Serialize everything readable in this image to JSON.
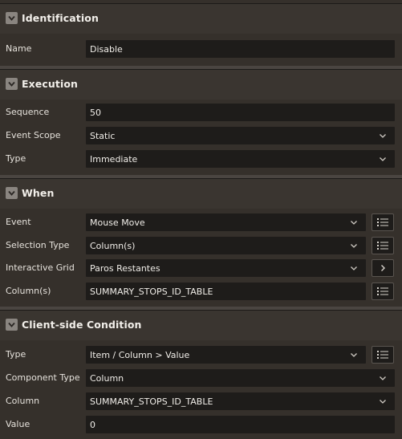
{
  "sections": {
    "identification": {
      "title": "Identification",
      "name": {
        "label": "Name",
        "value": "Disable"
      }
    },
    "execution": {
      "title": "Execution",
      "sequence": {
        "label": "Sequence",
        "value": "50"
      },
      "event_scope": {
        "label": "Event Scope",
        "value": "Static"
      },
      "type": {
        "label": "Type",
        "value": "Immediate"
      }
    },
    "when": {
      "title": "When",
      "event": {
        "label": "Event",
        "value": "Mouse Move"
      },
      "selection_type": {
        "label": "Selection Type",
        "value": "Column(s)"
      },
      "interactive_grid": {
        "label": "Interactive Grid",
        "value": "Paros Restantes"
      },
      "columns": {
        "label": "Column(s)",
        "value": "SUMMARY_STOPS_ID_TABLE"
      }
    },
    "client_side_condition": {
      "title": "Client-side Condition",
      "type": {
        "label": "Type",
        "value": "Item / Column > Value"
      },
      "component_type": {
        "label": "Component Type",
        "value": "Column"
      },
      "column": {
        "label": "Column",
        "value": "SUMMARY_STOPS_ID_TABLE"
      },
      "value": {
        "label": "Value",
        "value": "0"
      }
    }
  },
  "icons": {
    "collapse": "chevron-down-icon",
    "select": "chevron-down-icon",
    "list": "list-icon",
    "navigate": "chevron-right-icon"
  }
}
